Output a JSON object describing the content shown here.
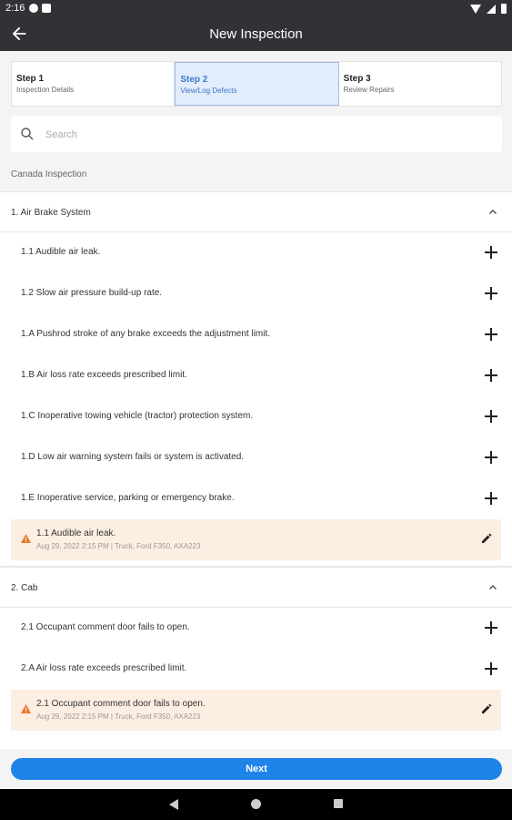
{
  "status": {
    "time": "2:16"
  },
  "appbar": {
    "title": "New Inspection",
    "back_icon": "arrow-back-icon"
  },
  "steps": [
    {
      "title": "Step 1",
      "subtitle": "Inspection Details",
      "active": false
    },
    {
      "title": "Step 2",
      "subtitle": "View/Log Defects",
      "active": true
    },
    {
      "title": "Step 3",
      "subtitle": "Review Repairs",
      "active": false
    }
  ],
  "search": {
    "placeholder": "Search"
  },
  "section_label": "Canada Inspection",
  "groups": [
    {
      "title": "1. Air Brake System",
      "items": [
        "1.1 Audible air leak.",
        "1.2 Slow air pressure build-up rate.",
        "1.A Pushrod stroke of any brake exceeds the adjustment limit.",
        "1.B Air loss rate exceeds prescribed limit.",
        "1.C Inoperative towing vehicle (tractor) protection system.",
        "1.D Low air warning system fails or system is activated.",
        "1.E Inoperative service, parking or emergency brake."
      ],
      "defect": {
        "title": "1.1 Audible air leak.",
        "meta": "Aug 29, 2022 2:15 PM | Truck, Ford F350, AXA223"
      }
    },
    {
      "title": "2. Cab",
      "items": [
        "2.1 Occupant comment door fails to open.",
        "2.A Air loss rate exceeds prescribed limit."
      ],
      "defect": {
        "title": "2.1 Occupant comment door fails to open.",
        "meta": "Aug 29, 2022 2:15 PM | Truck, Ford F350, AXA223"
      }
    }
  ],
  "next_label": "Next",
  "colors": {
    "accent": "#1e84e8",
    "warning": "#e8762b",
    "defect_bg": "#fdeee2",
    "appbar": "#303236"
  }
}
